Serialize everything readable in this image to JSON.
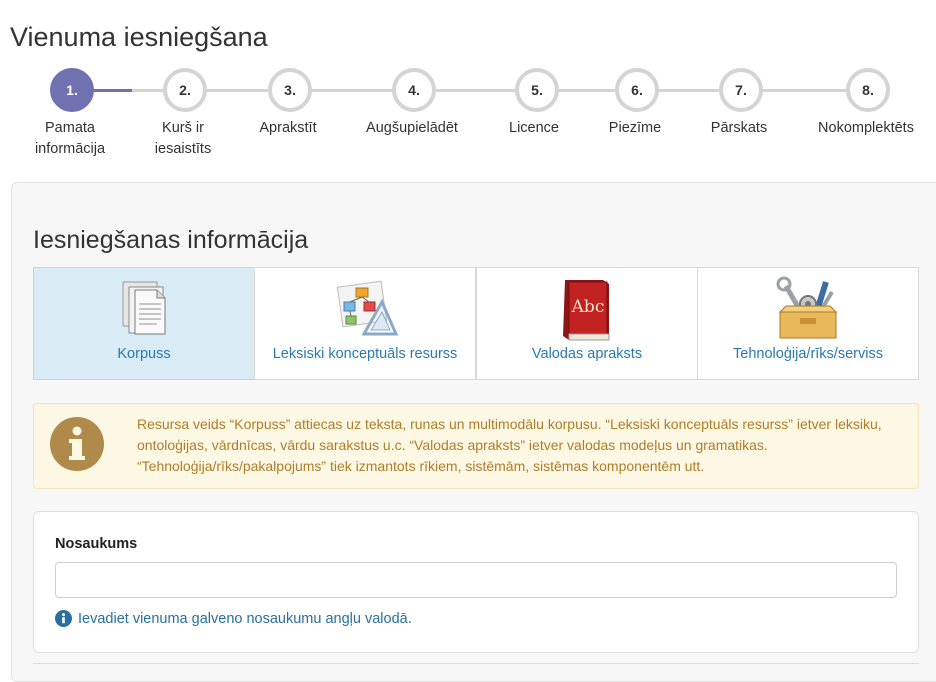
{
  "page": {
    "title": "Vienuma iesniegšana"
  },
  "stepper": {
    "active_step": 1,
    "steps": [
      {
        "number": "1.",
        "label": "Pamata informācija"
      },
      {
        "number": "2.",
        "label": "Kurš ir iesaistīts"
      },
      {
        "number": "3.",
        "label": "Aprakstīt"
      },
      {
        "number": "4.",
        "label": "Augšupielādēt"
      },
      {
        "number": "5.",
        "label": "Licence"
      },
      {
        "number": "6.",
        "label": "Piezīme"
      },
      {
        "number": "7.",
        "label": "Pārskats"
      },
      {
        "number": "8.",
        "label": "Nokomplektēts"
      }
    ]
  },
  "section": {
    "title": "Iesniegšanas informācija"
  },
  "resource_types": [
    {
      "label": "Korpuss",
      "icon": "documents-icon",
      "selected": true
    },
    {
      "label": "Leksiski konceptuāls resurss",
      "icon": "concept-diagram-icon",
      "selected": false
    },
    {
      "label": "Valodas apraksts",
      "icon": "abc-book-icon",
      "selected": false
    },
    {
      "label": "Tehnoloģija/rīks/serviss",
      "icon": "toolbox-icon",
      "selected": false
    }
  ],
  "info_alert": {
    "icon": "info-icon",
    "text": "Resursa veids “Korpuss” attiecas uz teksta, runas un multimodālu korpusu. “Leksiski konceptuāls resurss” ietver leksiku, ontoloģijas, vārdnīcas, vārdu sarakstus u.c. “Valodas apraksts” ietver valodas modeļus un gramatikas. “Tehnoloģija/rīks/pakalpojums” tiek izmantots rīkiem, sistēmām, sistēmas komponentēm utt."
  },
  "title_field": {
    "label": "Nosaukums",
    "value": "",
    "help": "Ievadiet vienuma galveno nosaukumu angļu valodā."
  },
  "colors": {
    "accent": "#6f71b0",
    "selected_bg": "#d9ebf5",
    "link": "#2a7ab0",
    "alert_text": "#b07d2b",
    "alert_bg": "#fcf8e3"
  }
}
